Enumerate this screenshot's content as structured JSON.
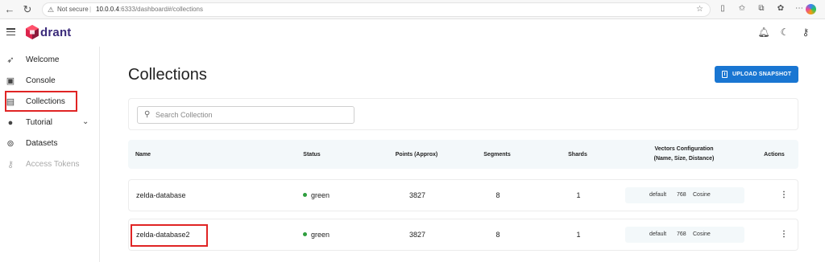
{
  "browser": {
    "security_label": "Not secure",
    "url_host": "10.0.0.4",
    "url_rest": ":6333/dashboard#/collections"
  },
  "app": {
    "logo_text": "drant"
  },
  "sidebar": {
    "items": [
      {
        "label": "Welcome",
        "icon": "rocket-icon"
      },
      {
        "label": "Console",
        "icon": "terminal-icon"
      },
      {
        "label": "Collections",
        "icon": "collections-icon"
      },
      {
        "label": "Tutorial",
        "icon": "lightbulb-icon"
      },
      {
        "label": "Datasets",
        "icon": "datasets-icon"
      },
      {
        "label": "Access Tokens",
        "icon": "key-icon"
      }
    ]
  },
  "main": {
    "title": "Collections",
    "upload_label": "UPLOAD SNAPSHOT",
    "search_placeholder": "Search Collection",
    "columns": {
      "name": "Name",
      "status": "Status",
      "points": "Points (Approx)",
      "segments": "Segments",
      "shards": "Shards",
      "vectors_line1": "Vectors Configuration",
      "vectors_line2": "(Name, Size, Distance)",
      "actions": "Actions"
    },
    "rows": [
      {
        "name": "zelda-database",
        "status": "green",
        "points": "3827",
        "segments": "8",
        "shards": "1",
        "vec_name": "default",
        "vec_size": "768",
        "vec_distance": "Cosine"
      },
      {
        "name": "zelda-database2",
        "status": "green",
        "points": "3827",
        "segments": "8",
        "shards": "1",
        "vec_name": "default",
        "vec_size": "768",
        "vec_distance": "Cosine"
      }
    ]
  },
  "colors": {
    "accent": "#1976d2",
    "status_green": "#2e9e3e",
    "highlight": "#e02424"
  }
}
